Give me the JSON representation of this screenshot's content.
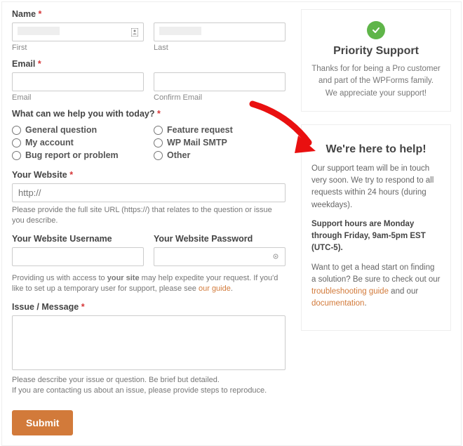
{
  "name": {
    "label": "Name",
    "first_sub": "First",
    "last_sub": "Last"
  },
  "email": {
    "label": "Email",
    "sub_email": "Email",
    "sub_confirm": "Confirm Email"
  },
  "question": {
    "label": "What can we help you with today?",
    "opts_left": [
      "General question",
      "My account",
      "Bug report or problem"
    ],
    "opts_right": [
      "Feature request",
      "WP Mail SMTP",
      "Other"
    ]
  },
  "website": {
    "label": "Your Website",
    "placeholder": "http://",
    "help": "Please provide the full site URL (https://) that relates to the question or issue you describe."
  },
  "creds": {
    "user_label": "Your Website Username",
    "pass_label": "Your Website Password",
    "help_1": "Providing us with access to ",
    "help_strong": "your site",
    "help_2": " may help expedite your request. If you'd like to set up a temporary user for support, please see ",
    "help_link": "our guide",
    "help_3": "."
  },
  "issue": {
    "label": "Issue / Message",
    "help_a": "Please describe your issue or question. Be brief but detailed.",
    "help_b": "If you are contacting us about an issue, please provide steps to reproduce."
  },
  "submit": "Submit",
  "priority": {
    "title": "Priority Support",
    "text": "Thanks for for being a Pro customer and part of the WPForms family. We appreciate your support!"
  },
  "help_card": {
    "title": "We're here to help!",
    "p1": "Our support team will be in touch very soon. We try to respond to all requests within 24 hours (during weekdays).",
    "p2": "Support hours are Monday through Friday, 9am-5pm EST (UTC-5).",
    "p3_a": "Want to get a head start on finding a solution? Be sure to check out our ",
    "p3_link1": "troubleshooting guide",
    "p3_b": " and our ",
    "p3_link2": "documentation",
    "p3_c": "."
  }
}
